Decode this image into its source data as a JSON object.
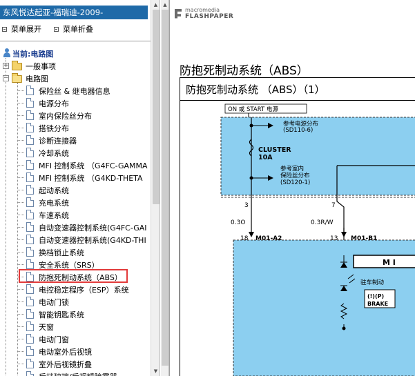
{
  "left": {
    "title": "东风悦达起亚-福瑞迪-2009-",
    "expand_all": "菜单展开",
    "collapse_all": "菜单折叠",
    "current_label": "当前:电路图",
    "folder_general": "一般事项",
    "folder_circuit": "电路图",
    "items": [
      "保险丝 & 继电器信息",
      "电源分布",
      "室内保险丝分布",
      "搭铁分布",
      "诊断连接器",
      "冷却系统",
      "MFI 控制系统 （G4FC-GAMMA",
      "MFI 控制系统 （G4KD-THETA",
      "起动系统",
      "充电系统",
      "车速系统",
      "自动变速器控制系统(G4FC-GAI",
      "自动变速器控制系统(G4KD-THI",
      "换档锁止系统",
      "安全系统（SRS）",
      "防抱死制动系统（ABS）",
      "电控稳定程序（ESP）系统",
      "电动门锁",
      "智能钥匙系统",
      "天窗",
      "电动门窗",
      "电动室外后视镜",
      "室外后视镜折叠",
      "后挡玻璃/后视镜除雾器"
    ],
    "selected_index": 15
  },
  "viewer": {
    "logo_line1": "macromedia",
    "logo_line2": "FLASHPAPER",
    "doc_title": "防抱死制动系统（ABS）",
    "sub_title": "防抱死制动系统 （ABS）（1）"
  },
  "diagram": {
    "on_start_label": "ON 或 START 电源",
    "ref_power_dist": "参考电源分布",
    "ref_power_code": "(SD110-6)",
    "cluster_label": "CLUSTER",
    "cluster_amp": "10A",
    "ref_indoor_1": "参考室内",
    "ref_indoor_2": "保险丝分布",
    "ref_indoor_code": "(SD120-1)",
    "pin_3": "3",
    "pin_7": "7",
    "wire_1": "0.3O",
    "wire_2": "0.3R/W",
    "pin_18": "18",
    "conn_1": "M01-A2",
    "pin_13": "13",
    "conn_2": "M01-B1",
    "module_letters": "M I",
    "park_brake": "驻车制动",
    "brake_text": "BRAKE",
    "brake_icon": "(!)(P)",
    "colors": {
      "blue_fill": "#8ccff0"
    }
  }
}
